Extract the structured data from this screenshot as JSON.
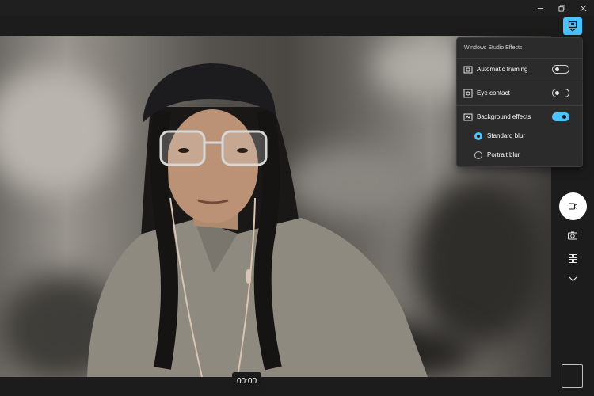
{
  "window": {
    "minimize_icon": "minimize-icon",
    "restore_icon": "restore-icon",
    "close_icon": "close-icon"
  },
  "effects_panel": {
    "title": "Windows Studio Effects",
    "items": [
      {
        "label": "Automatic framing",
        "icon": "framing-icon",
        "enabled": false
      },
      {
        "label": "Eye contact",
        "icon": "eye-contact-icon",
        "enabled": false
      },
      {
        "label": "Background effects",
        "icon": "background-effects-icon",
        "enabled": true
      }
    ],
    "blur_options": [
      {
        "label": "Standard blur",
        "selected": true
      },
      {
        "label": "Portrait blur",
        "selected": false
      }
    ]
  },
  "controls": {
    "shutter_icon": "video-camera-icon",
    "photo_mode_icon": "camera-icon",
    "qr_mode_icon": "qr-code-icon",
    "more_icon": "chevron-down-icon"
  },
  "recording": {
    "timer": "00:00"
  },
  "colors": {
    "accent": "#4cc2ff",
    "panel_bg": "#2b2b2b",
    "chrome_bg": "#1c1c1c"
  }
}
